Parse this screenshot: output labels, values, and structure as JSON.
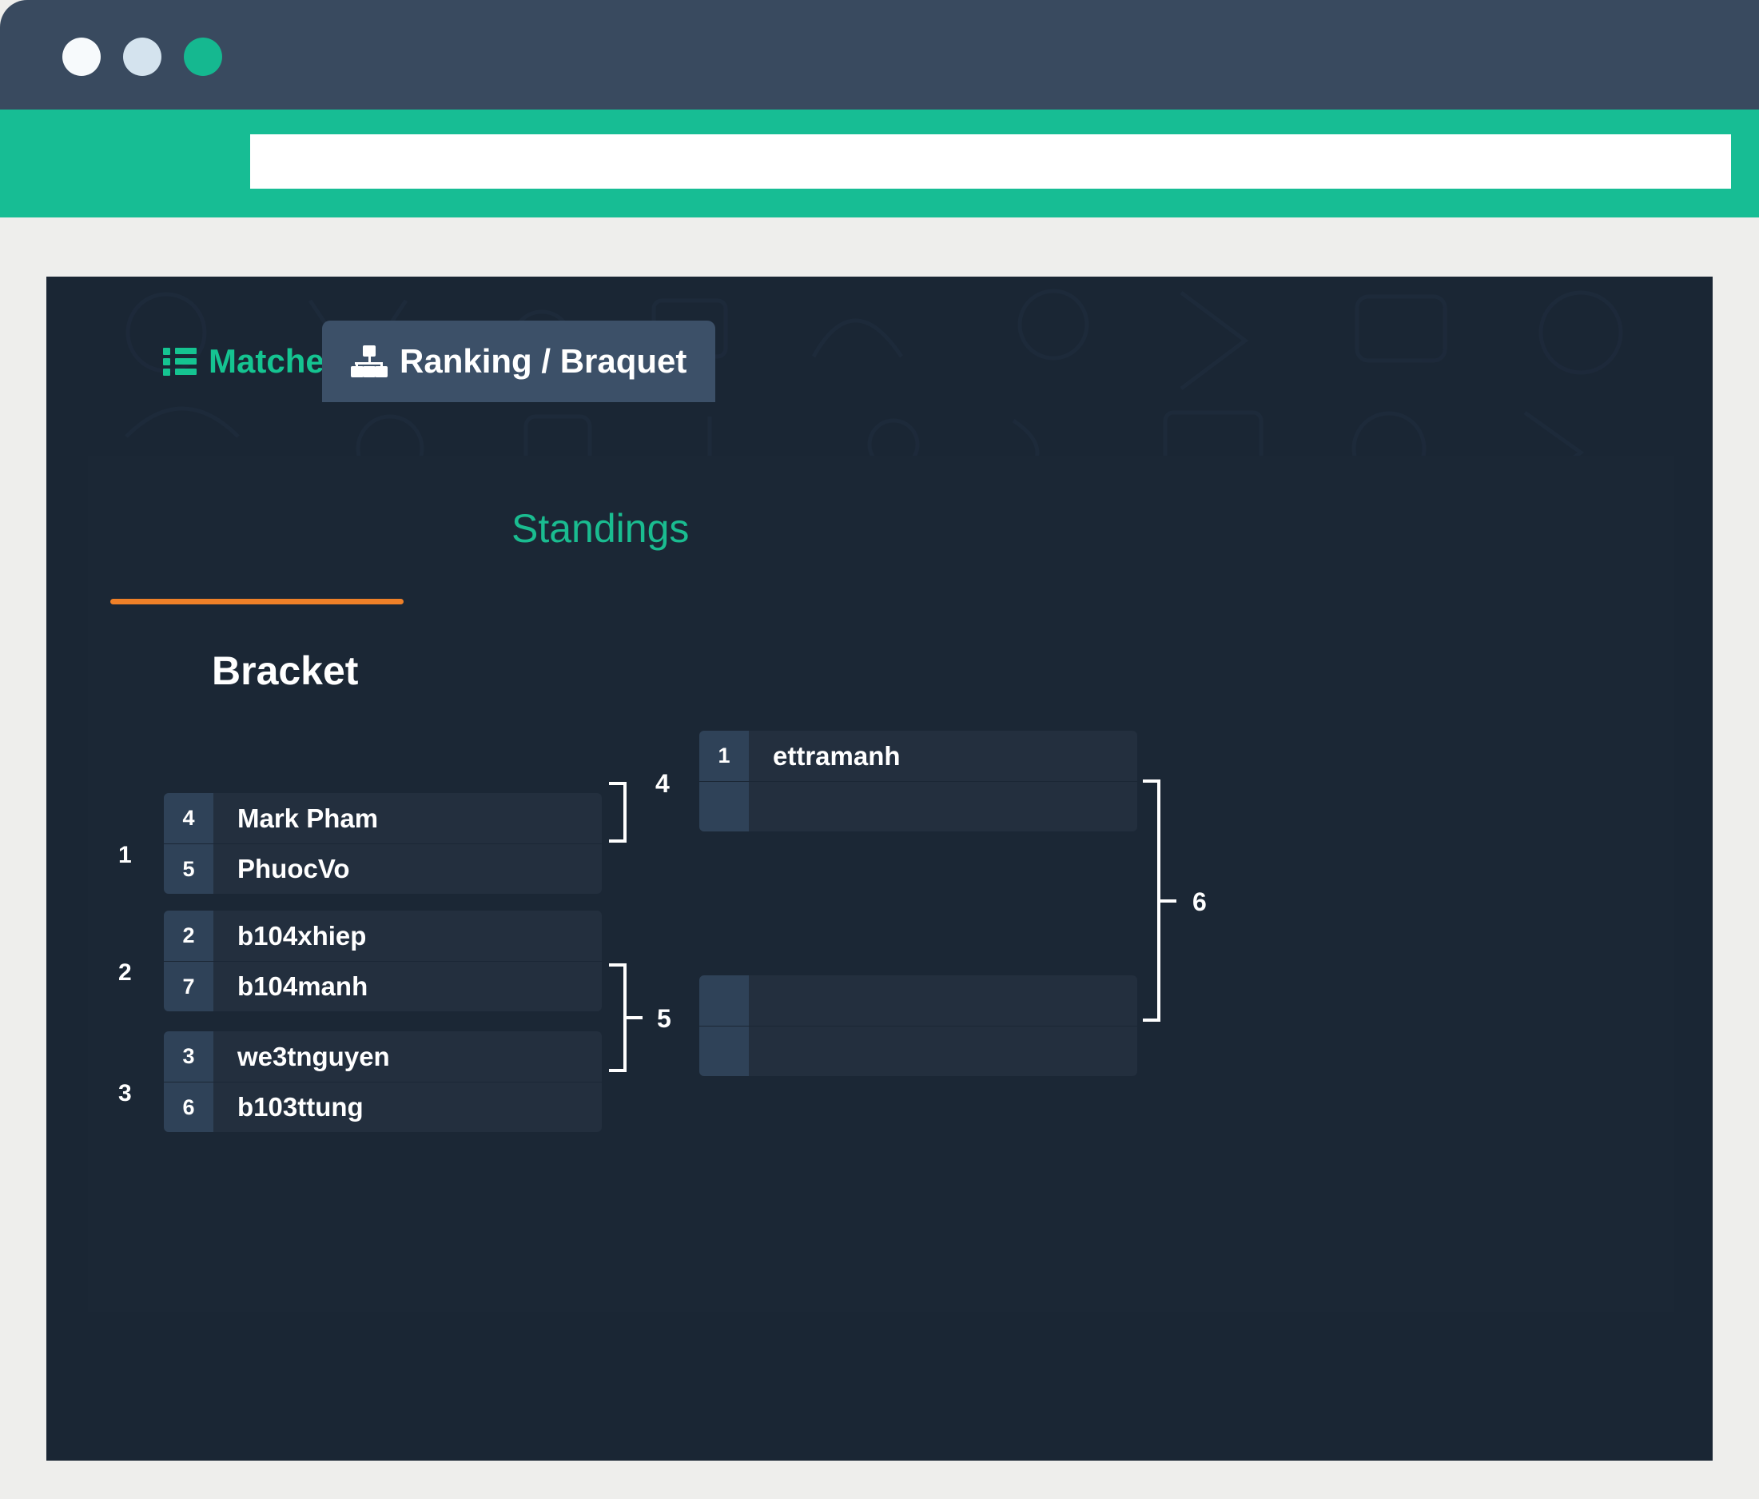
{
  "browser": {
    "url_value": "",
    "url_placeholder": "",
    "traffic_lights": [
      "close-dot",
      "minimize-dot",
      "maximize-dot"
    ],
    "colors": {
      "titlebar": "#394a5f",
      "urlbar_strip": "#17bd94",
      "dot_white": "#f7fafc",
      "dot_blue": "#d4e3ee",
      "dot_green": "#15b890"
    }
  },
  "app": {
    "tabs": [
      {
        "label": "Matches",
        "icon": "list-icon",
        "active": false
      },
      {
        "label": "Ranking / Braquet",
        "icon": "sitemap-icon",
        "active": true
      }
    ],
    "subtabs": [
      {
        "label": "Bracket",
        "active": true
      },
      {
        "label": "Standings",
        "active": false
      }
    ],
    "accent_underline_color": "#ef8028",
    "card_bg": "#1a2634",
    "panel_bg": "#1b2735"
  },
  "bracket": {
    "round1": [
      {
        "index": "1",
        "slots": [
          {
            "seed": "4",
            "name": "Mark Pham"
          },
          {
            "seed": "5",
            "name": "PhuocVo"
          }
        ]
      },
      {
        "index": "2",
        "slots": [
          {
            "seed": "2",
            "name": "b104xhiep"
          },
          {
            "seed": "7",
            "name": "b104manh"
          }
        ]
      },
      {
        "index": "3",
        "slots": [
          {
            "seed": "3",
            "name": "we3tnguyen"
          },
          {
            "seed": "6",
            "name": "b103ttung"
          }
        ]
      }
    ],
    "round2": [
      {
        "index": "4",
        "slots": [
          {
            "seed": "1",
            "name": "ettramanh"
          },
          {
            "seed": "",
            "name": ""
          }
        ]
      },
      {
        "index": "5",
        "slots": [
          {
            "seed": "",
            "name": ""
          },
          {
            "seed": "",
            "name": ""
          }
        ]
      }
    ],
    "round3": [
      {
        "index": "6"
      }
    ],
    "connector_labels": {
      "c4": "4",
      "c5": "5",
      "c6": "6"
    }
  }
}
